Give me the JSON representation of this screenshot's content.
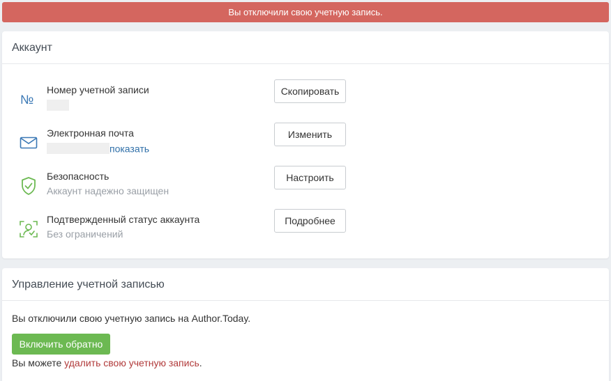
{
  "alert": {
    "text": "Вы отключили свою учетную запись.",
    "color": "#d4665f"
  },
  "account": {
    "title": "Аккаунт",
    "rows": [
      {
        "icon": "number-icon",
        "title": "Номер учетной записи",
        "button": "Скопировать"
      },
      {
        "icon": "envelope-icon",
        "title": "Электронная почта",
        "show_link": "показать",
        "button": "Изменить"
      },
      {
        "icon": "shield-check-icon",
        "title": "Безопасность",
        "subtitle": "Аккаунт надежно защищен",
        "button": "Настроить"
      },
      {
        "icon": "verified-user-icon",
        "title": "Подтвержденный статус аккаунта",
        "subtitle": "Без ограничений",
        "button": "Подробнее"
      }
    ]
  },
  "manage": {
    "title": "Управление учетной записью",
    "text": "Вы отключили свою учетную запись на Author.Today.",
    "enable_button": "Включить обратно",
    "note_prefix": "Вы можете ",
    "delete_link": "удалить свою учетную запись",
    "note_suffix": "."
  },
  "colors": {
    "accent_blue": "#3a78b5",
    "green": "#6cb952",
    "danger": "#b13a3a"
  }
}
